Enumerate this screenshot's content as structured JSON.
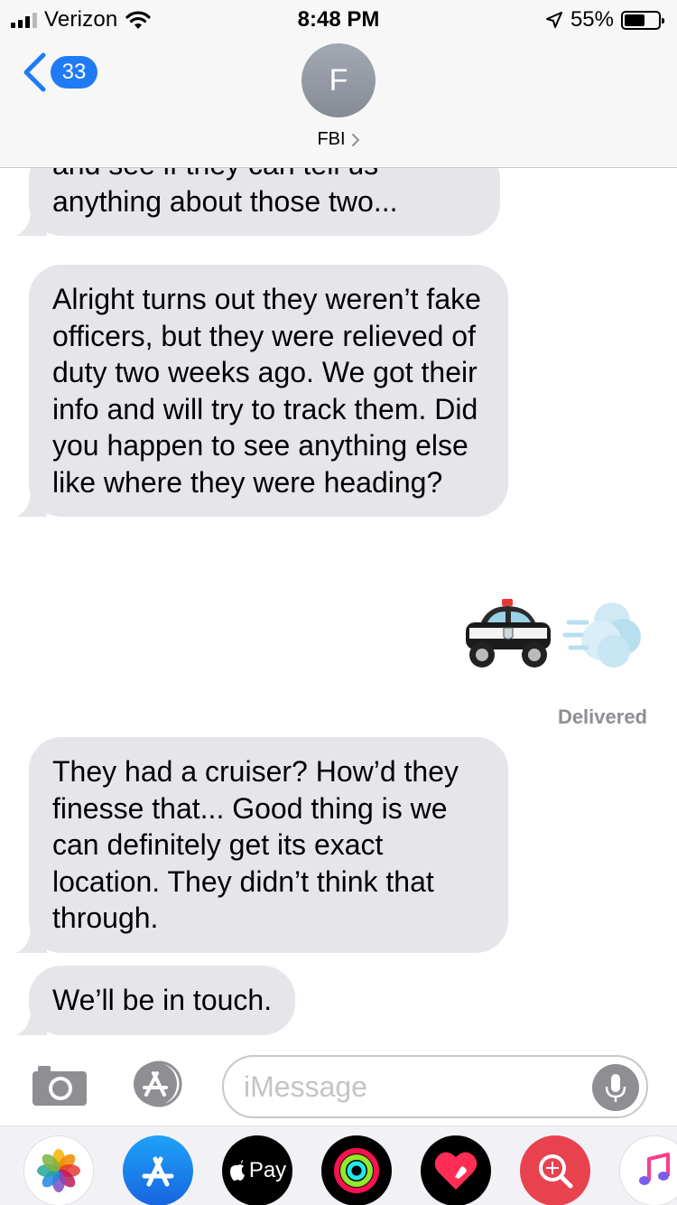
{
  "status_bar": {
    "carrier": "Verizon",
    "time": "8:48 PM",
    "battery": "55%"
  },
  "header": {
    "back_count": "33",
    "avatar_initial": "F",
    "contact_name": "FBI"
  },
  "messages": [
    {
      "text": "and see if they can tell us anything about those two..."
    },
    {
      "text": "Alright turns out they weren’t fake officers, but they were relieved of duty two weeks ago. We got their info and will try to track them. Did you happen to see anything else like where they were heading?"
    },
    {
      "emoji": [
        "police-car",
        "dash-away"
      ]
    },
    {
      "text": "They had a cruiser? How’d they finesse that... Good thing is we can definitely get its exact location. They didn’t think that through."
    },
    {
      "text": "We’ll be in touch."
    }
  ],
  "delivered_label": "Delivered",
  "input": {
    "placeholder": "iMessage"
  },
  "app_drawer": [
    {
      "icon": "photos-icon"
    },
    {
      "icon": "app-store-icon"
    },
    {
      "icon": "apple-pay-icon",
      "label": "Pay"
    },
    {
      "icon": "activity-icon"
    },
    {
      "icon": "digital-touch-icon"
    },
    {
      "icon": "image-search-icon"
    },
    {
      "icon": "music-icon"
    }
  ],
  "colors": {
    "accent": "#1f7bf5",
    "bubble": "#e5e5ea",
    "delivered": "#8e8e93"
  }
}
